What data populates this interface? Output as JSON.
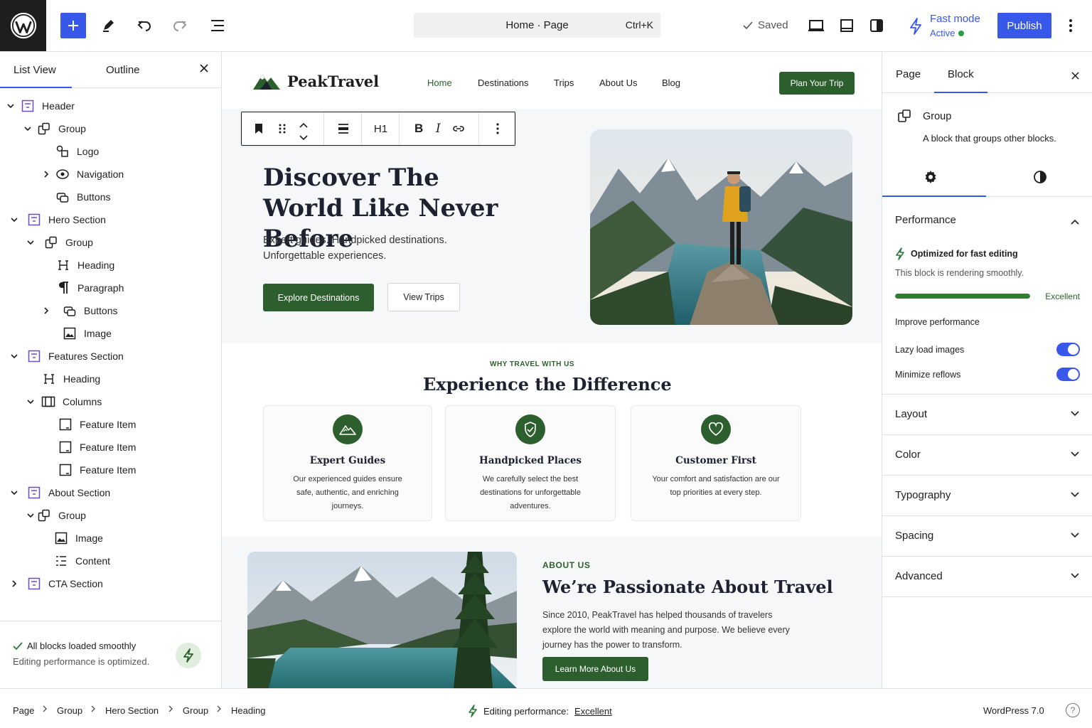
{
  "topbar": {
    "command_title": "Home · Page",
    "command_shortcut": "Ctrl+K",
    "saved_label": "Saved",
    "fast_mode_label": "Fast mode",
    "fast_mode_status": "Active",
    "publish_label": "Publish",
    "icons": [
      "wordpress-logo",
      "plus-icon",
      "pencil-icon",
      "undo-icon",
      "redo-icon",
      "document-overview-icon",
      "check-icon",
      "desktop-icon",
      "tablet-icon",
      "style-icon",
      "bolt-icon",
      "more-vertical-icon"
    ]
  },
  "left_panel": {
    "tabs": [
      {
        "label": "List View"
      },
      {
        "label": "Outline"
      }
    ],
    "tree": [
      {
        "label": "Header",
        "depth": 0,
        "expanded": true,
        "icon": "template-part-icon"
      },
      {
        "label": "Group",
        "depth": 1,
        "expanded": true,
        "icon": "group-icon"
      },
      {
        "label": "Logo",
        "depth": 2,
        "icon": "logo-icon"
      },
      {
        "label": "Navigation",
        "depth": 2,
        "expanded": false,
        "icon": "navigation-icon"
      },
      {
        "label": "Buttons",
        "depth": 2,
        "icon": "buttons-icon"
      },
      {
        "label": "Hero Section",
        "depth": 0,
        "expanded": true,
        "icon": "template-part-icon"
      },
      {
        "label": "Group",
        "depth": 1,
        "expanded": true,
        "icon": "group-icon"
      },
      {
        "label": "Heading",
        "depth": 2,
        "icon": "heading-icon"
      },
      {
        "label": "Paragraph",
        "depth": 2,
        "icon": "paragraph-icon"
      },
      {
        "label": "Buttons",
        "depth": 2,
        "expanded": false,
        "icon": "buttons-icon"
      },
      {
        "label": "Image",
        "depth": 2,
        "icon": "image-icon"
      },
      {
        "label": "Features Section",
        "depth": 0,
        "expanded": true,
        "icon": "template-part-icon"
      },
      {
        "label": "Heading",
        "depth": 1,
        "icon": "heading-icon"
      },
      {
        "label": "Columns",
        "depth": 1,
        "expanded": true,
        "icon": "columns-icon"
      },
      {
        "label": "Feature Item",
        "depth": 2,
        "icon": "column-icon"
      },
      {
        "label": "Feature Item",
        "depth": 2,
        "icon": "column-icon"
      },
      {
        "label": "Feature Item",
        "depth": 2,
        "icon": "column-icon"
      },
      {
        "label": "About Section",
        "depth": 0,
        "expanded": true,
        "icon": "template-part-icon"
      },
      {
        "label": "Group",
        "depth": 1,
        "expanded": true,
        "icon": "group-icon"
      },
      {
        "label": "Image",
        "depth": 2,
        "icon": "image-icon"
      },
      {
        "label": "Content",
        "depth": 2,
        "icon": "list-icon"
      },
      {
        "label": "CTA Section",
        "depth": 0,
        "expanded": false,
        "icon": "template-part-icon"
      }
    ],
    "status_title": "All blocks loaded smoothly",
    "status_desc": "Editing performance is optimized."
  },
  "canvas": {
    "brand_name": "PeakTravel",
    "nav": [
      "Home",
      "Destinations",
      "Trips",
      "About Us",
      "Blog"
    ],
    "nav_active": "Home",
    "plan_button": "Plan Your Trip",
    "toolbar": {
      "heading_level": "H1",
      "bold": "B",
      "italic": "I"
    },
    "hero": {
      "title": "Discover The World Like Never Before",
      "subtitle": "Expert guides. Handpicked destinations. Unforgettable experiences.",
      "primary_button": "Explore Destinations",
      "secondary_button": "View Trips"
    },
    "features": {
      "eyebrow": "WHY TRAVEL WITH US",
      "title": "Experience the Difference",
      "cards": [
        {
          "title": "Expert Guides",
          "desc": "Our experienced guides ensure safe, authentic, and enriching journeys.",
          "icon": "mountain-icon"
        },
        {
          "title": "Handpicked Places",
          "desc": "We carefully select the best destinations for unforgettable adventures.",
          "icon": "shield-check-icon"
        },
        {
          "title": "Customer First",
          "desc": "Your comfort and satisfaction are our top priorities at every step.",
          "icon": "heart-icon"
        }
      ]
    },
    "about": {
      "eyebrow": "ABOUT US",
      "title": "We’re Passionate About Travel",
      "desc": "Since 2010, PeakTravel has helped thousands of travelers explore the world with meaning and purpose. We believe every journey has the power to transform.",
      "button": "Learn More About Us"
    }
  },
  "right_panel": {
    "tabs": [
      {
        "label": "Page"
      },
      {
        "label": "Block"
      }
    ],
    "active_tab": "Block",
    "block_name": "Group",
    "block_desc": "A block that groups other blocks.",
    "performance": {
      "title": "Performance",
      "optimized": "Optimized for fast editing",
      "rendering": "This block is rendering smoothly.",
      "score_label": "Excellent",
      "score_fraction": 1.0,
      "improve_label": "Improve performance",
      "toggles": [
        {
          "label": "Lazy load images",
          "on": true
        },
        {
          "label": "Minimize reflows",
          "on": true
        }
      ]
    },
    "sections": [
      "Layout",
      "Color",
      "Typography",
      "Spacing",
      "Advanced"
    ]
  },
  "footer": {
    "breadcrumbs": [
      "Page",
      "Group",
      "Hero Section",
      "Group",
      "Heading"
    ],
    "perf_prefix": "Editing performance:",
    "perf_value": "Excellent",
    "version": "WordPress 7.0",
    "help": "?"
  },
  "colors": {
    "accent": "#3858e9",
    "brand_green": "#2c5f2d",
    "success": "#2e9a45"
  }
}
